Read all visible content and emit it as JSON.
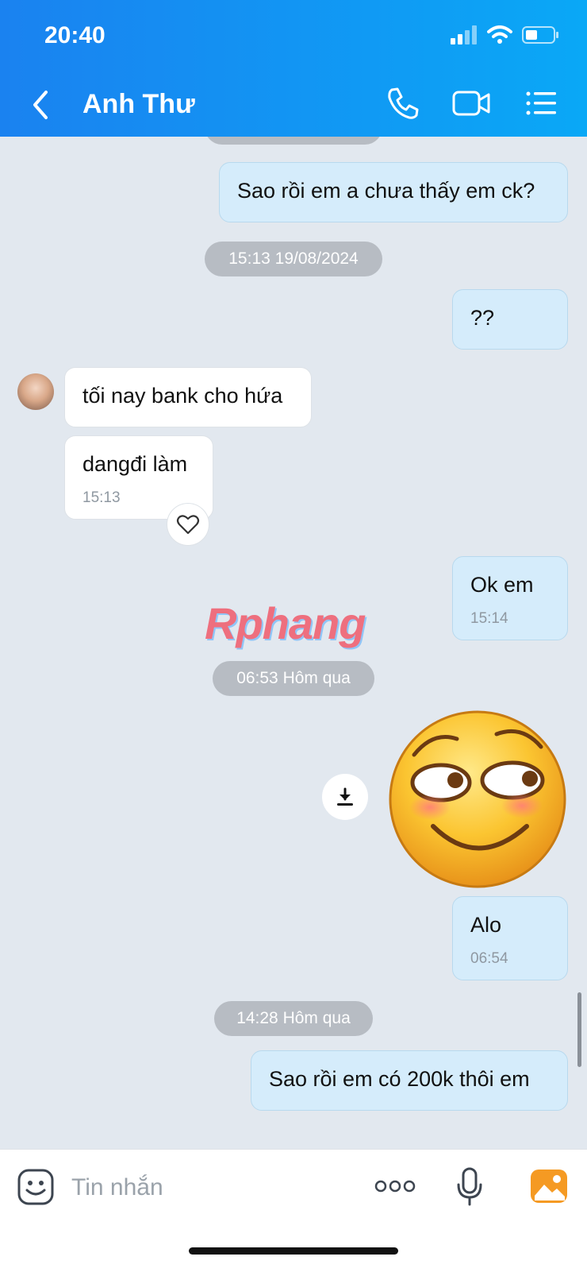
{
  "status": {
    "time": "20:40"
  },
  "header": {
    "contact_name": "Anh Thư"
  },
  "messages": {
    "m1": {
      "text": "Sao rồi em a chưa thấy em ck?"
    },
    "d1": {
      "text": "15:13 19/08/2024"
    },
    "m2": {
      "text": "??"
    },
    "m3": {
      "text": "tối nay bank cho hứa"
    },
    "m4": {
      "text": "dangđi làm",
      "time": "15:13"
    },
    "m5": {
      "text": "Ok em",
      "time": "15:14"
    },
    "d2": {
      "text": "06:53 Hôm qua"
    },
    "m6": {
      "text": "Alo",
      "time": "06:54"
    },
    "d3": {
      "text": "14:28 Hôm qua"
    },
    "m7": {
      "text": "Sao rồi em có 200k thôi em"
    }
  },
  "watermark": {
    "text": "Rphang"
  },
  "composer": {
    "placeholder": "Tin nhắn"
  },
  "colors": {
    "header_start": "#1a82f0",
    "header_end": "#0aa8f6",
    "my_bubble": "#d5ecfb",
    "their_bubble": "#ffffff",
    "chat_bg": "#e2e8ef"
  },
  "icons": [
    "back-icon",
    "phone-icon",
    "video-call-icon",
    "menu-list-icon",
    "heart-icon",
    "download-icon",
    "sticker-emoji",
    "emoji-icon",
    "more-icon",
    "microphone-icon",
    "image-icon"
  ]
}
